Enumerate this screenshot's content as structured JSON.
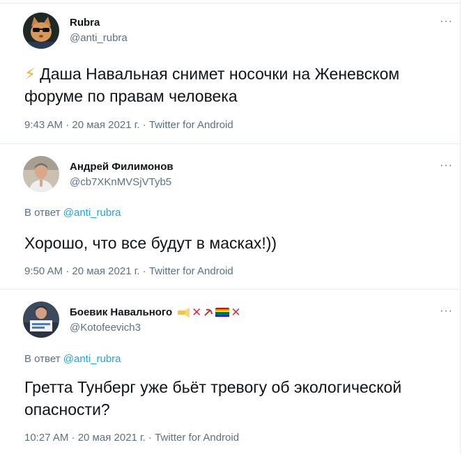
{
  "tweets": [
    {
      "name": "Rubra",
      "handle": "@anti_rubra",
      "more": "···",
      "emoji": "⚡",
      "text": "Даша Навальная снимет носочки на Женевском форуме по правам человека",
      "meta": "9:43 AM · 20 мая 2021 г. · Twitter for Android",
      "avatar_icon": "cat-with-sunglasses-avatar"
    },
    {
      "name": "Андрей Филимонов",
      "handle": "@cb7XKnMVSjVTyb5",
      "more": "···",
      "reply_prefix": "В ответ",
      "reply_mention": "@anti_rubra",
      "text": "Хорошо, что все будут в масках!))",
      "meta": "9:50 AM · 20 мая 2021 г. · Twitter for Android",
      "avatar_icon": "man-portrait-avatar"
    },
    {
      "name": "Боевик Навального",
      "name_emojis": [
        "flashlight-icon",
        "cross-mark-icon",
        "hammer-sickle-icon",
        "rainbow-flag-icon",
        "cross-mark-icon"
      ],
      "handle": "@Kotofeevich3",
      "more": "···",
      "reply_prefix": "В ответ",
      "reply_mention": "@anti_rubra",
      "text": "Гретта Тунберг уже бьёт тревогу об экологической опасности?",
      "meta": "10:27 AM · 20 мая 2021 г. · Twitter for Android",
      "avatar_icon": "person-holding-sign-avatar"
    }
  ],
  "colors": {
    "text": "#0f1419",
    "secondary": "#5b7083",
    "link": "#1da1f2",
    "divider": "#e6ecf0"
  }
}
